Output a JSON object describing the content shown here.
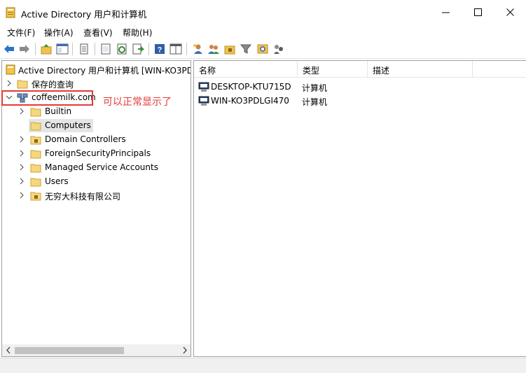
{
  "window": {
    "title": "Active Directory 用户和计算机"
  },
  "menu": [
    "文件(F)",
    "操作(A)",
    "查看(V)",
    "帮助(H)"
  ],
  "toolbar": {
    "icons": [
      "back-arrow-icon",
      "forward-arrow-icon",
      "up-folder-icon",
      "console-tree-icon",
      "properties-icon",
      "export-list-icon",
      "refresh-icon",
      "export-icon",
      "help-icon",
      "show-hide-icon",
      "new-user-icon",
      "new-group-icon",
      "new-ou-icon",
      "filter-icon",
      "find-icon",
      "add-to-group-icon"
    ]
  },
  "tree": {
    "root": "Active Directory 用户和计算机 [WIN-KO3PD",
    "saved_queries": "保存的查询",
    "domain": "coffeemilk.com",
    "children": [
      "Builtin",
      "Computers",
      "Domain Controllers",
      "ForeignSecurityPrincipals",
      "Managed Service Accounts",
      "Users",
      "无穷大科技有限公司"
    ],
    "selected": "Computers"
  },
  "annotation": {
    "text": "可以正常显示了",
    "color": "#e53935"
  },
  "list": {
    "columns": [
      "名称",
      "类型",
      "描述"
    ],
    "rows": [
      {
        "name": "DESKTOP-KTU715D",
        "type": "计算机",
        "description": ""
      },
      {
        "name": "WIN-KO3PDLGI470",
        "type": "计算机",
        "description": ""
      }
    ]
  }
}
